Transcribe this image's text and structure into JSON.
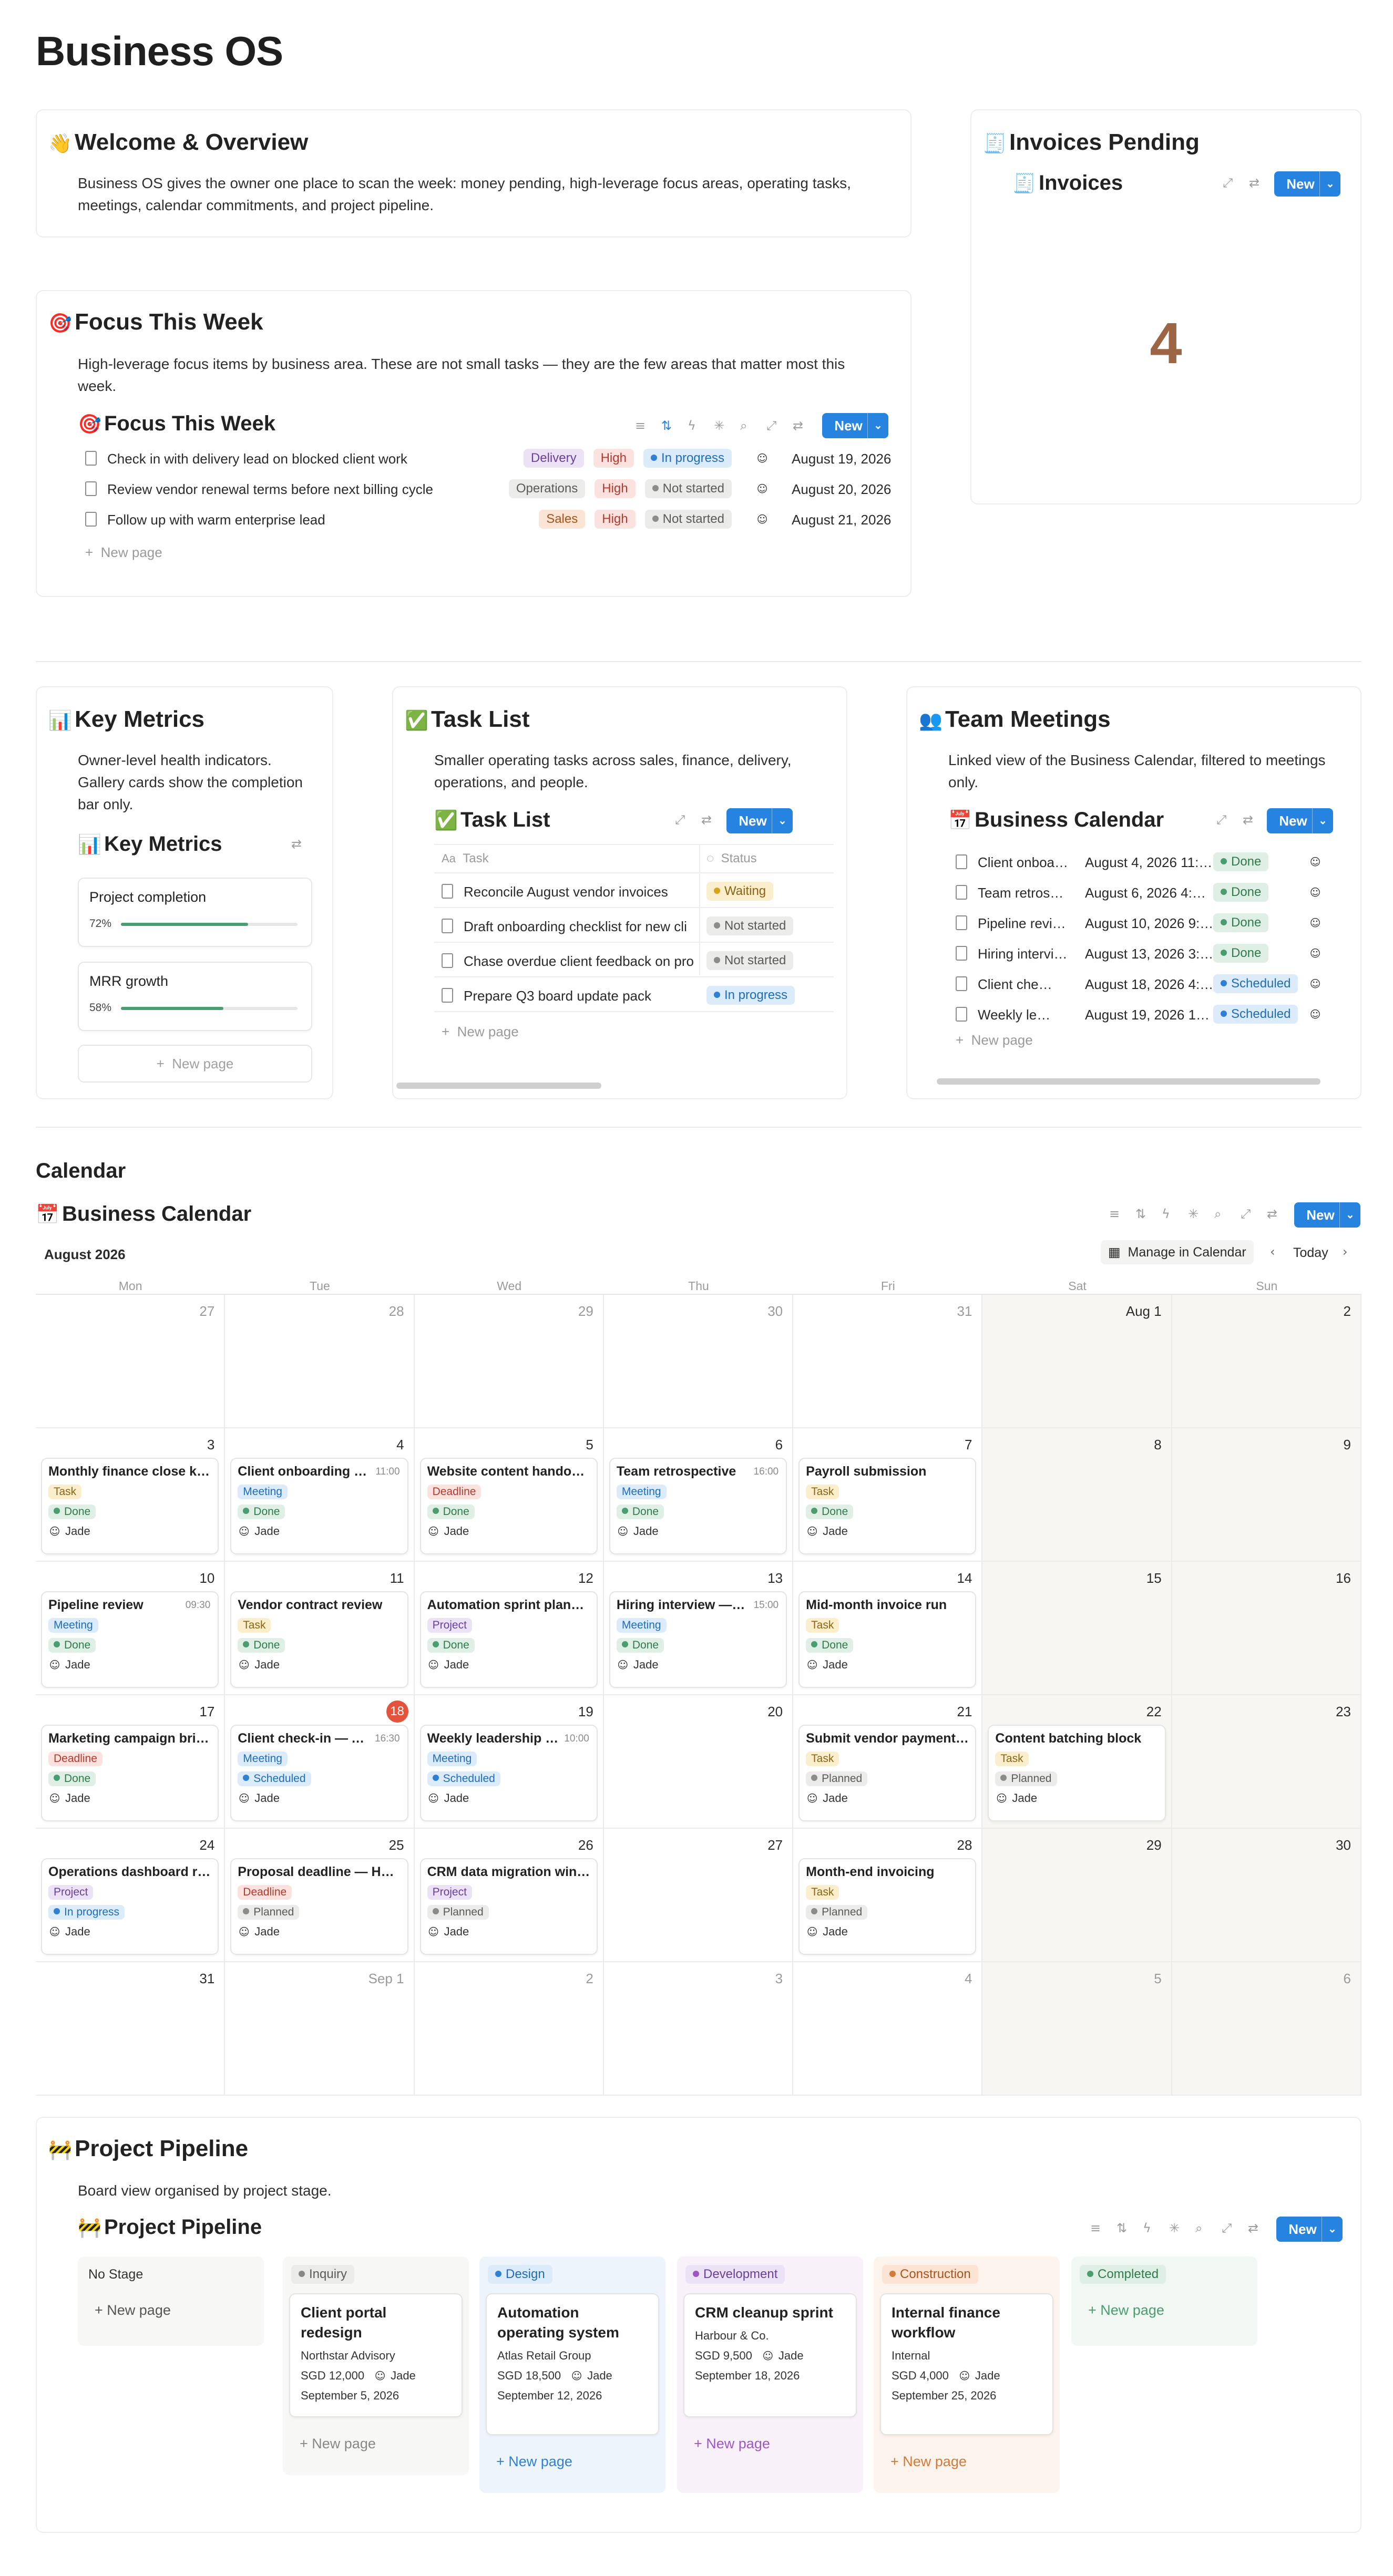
{
  "page": {
    "title": "Business OS"
  },
  "welcome": {
    "emoji": "👋",
    "title": "Welcome & Overview",
    "desc": "Business OS gives the owner one place to scan the week: money pending, high-leverage focus areas, operating tasks, meetings, calendar commitments, and project pipeline."
  },
  "invoices": {
    "emoji": "🧾",
    "title": "Invoices Pending",
    "view_title": "Invoices",
    "new_label": "New",
    "count": "4"
  },
  "focus": {
    "emoji": "🎯",
    "title": "Focus This Week",
    "desc": "High-leverage focus items by business area. These are not small tasks — they are the few areas that matter most this week.",
    "view_title": "Focus This Week",
    "new_label": "New",
    "new_page": "New page",
    "rows": [
      {
        "title": "Check in with delivery lead on blocked client work",
        "area": "Delivery",
        "priority": "High",
        "status": "In progress",
        "date": "August 19, 2026"
      },
      {
        "title": "Review vendor renewal terms before next billing cycle",
        "area": "Operations",
        "priority": "High",
        "status": "Not started",
        "date": "August 20, 2026"
      },
      {
        "title": "Follow up with warm enterprise lead",
        "area": "Sales",
        "priority": "High",
        "status": "Not started",
        "date": "August 21, 2026"
      }
    ]
  },
  "metrics": {
    "emoji": "📊",
    "title": "Key Metrics",
    "desc": "Owner-level health indicators. Gallery cards show the completion bar only.",
    "view_title": "Key Metrics",
    "new_page": "New page",
    "cards": [
      {
        "name": "Project completion",
        "pct_label": "72%",
        "pct": 0.72
      },
      {
        "name": "MRR growth",
        "pct_label": "58%",
        "pct": 0.58
      }
    ]
  },
  "tasks": {
    "emoji": "✅",
    "title": "Task List",
    "desc": "Smaller operating tasks across sales, finance, delivery, operations, and people.",
    "view_title": "Task List",
    "new_label": "New",
    "col_task": "Task",
    "col_status": "Status",
    "new_page": "New page",
    "rows": [
      {
        "title": "Reconcile August vendor invoices",
        "status": "Waiting"
      },
      {
        "title": "Draft onboarding checklist for new cli",
        "status": "Not started"
      },
      {
        "title": "Chase overdue client feedback on pro",
        "status": "Not started"
      },
      {
        "title": "Prepare Q3 board update pack",
        "status": "In progress"
      }
    ]
  },
  "meetings": {
    "emoji": "👥",
    "title": "Team Meetings",
    "desc": "Linked view of the Business Calendar, filtered to meetings only.",
    "view_title": "Business Calendar",
    "new_label": "New",
    "new_page": "New page",
    "rows": [
      {
        "title": "Client onboa…",
        "date": "August 4, 2026 11:…",
        "status": "Done"
      },
      {
        "title": "Team retros…",
        "date": "August 6, 2026 4:…",
        "status": "Done"
      },
      {
        "title": "Pipeline revi…",
        "date": "August 10, 2026 9:…",
        "status": "Done"
      },
      {
        "title": "Hiring intervi…",
        "date": "August 13, 2026 3:…",
        "status": "Done"
      },
      {
        "title": "Client che…",
        "date": "August 18, 2026 4:…",
        "status": "Scheduled"
      },
      {
        "title": "Weekly le…",
        "date": "August 19, 2026 1…",
        "status": "Scheduled"
      }
    ]
  },
  "calendar": {
    "section_title": "Calendar",
    "view_title": "Business Calendar",
    "new_label": "New",
    "month": "August 2026",
    "manage_label": "Manage in Calendar",
    "today_label": "Today",
    "weekdays": [
      "Mon",
      "Tue",
      "Wed",
      "Thu",
      "Fri",
      "Sat",
      "Sun"
    ],
    "weeks": [
      [
        {
          "n": "27",
          "dim": true
        },
        {
          "n": "28",
          "dim": true
        },
        {
          "n": "29",
          "dim": true
        },
        {
          "n": "30",
          "dim": true
        },
        {
          "n": "31",
          "dim": true
        },
        {
          "n": "Aug 1"
        },
        {
          "n": "2"
        }
      ],
      [
        {
          "n": "3",
          "ev": {
            "title": "Monthly finance close ki…",
            "type": "Task",
            "status": "Done"
          }
        },
        {
          "n": "4",
          "ev": {
            "title": "Client onboarding c…",
            "time": "11:00",
            "type": "Meeting",
            "status": "Done"
          }
        },
        {
          "n": "5",
          "ev": {
            "title": "Website content handov…",
            "type": "Deadline",
            "status": "Done"
          }
        },
        {
          "n": "6",
          "ev": {
            "title": "Team retrospective",
            "time": "16:00",
            "type": "Meeting",
            "status": "Done"
          }
        },
        {
          "n": "7",
          "ev": {
            "title": "Payroll submission",
            "type": "Task",
            "status": "Done"
          }
        },
        {
          "n": "8"
        },
        {
          "n": "9"
        }
      ],
      [
        {
          "n": "10",
          "ev": {
            "title": "Pipeline review",
            "time": "09:30",
            "type": "Meeting",
            "status": "Done"
          }
        },
        {
          "n": "11",
          "ev": {
            "title": "Vendor contract review",
            "type": "Task",
            "status": "Done"
          }
        },
        {
          "n": "12",
          "ev": {
            "title": "Automation sprint plann…",
            "type": "Project",
            "status": "Done"
          }
        },
        {
          "n": "13",
          "ev": {
            "title": "Hiring interview — …",
            "time": "15:00",
            "type": "Meeting",
            "status": "Done"
          }
        },
        {
          "n": "14",
          "ev": {
            "title": "Mid-month invoice run",
            "type": "Task",
            "status": "Done"
          }
        },
        {
          "n": "15"
        },
        {
          "n": "16"
        }
      ],
      [
        {
          "n": "17",
          "ev": {
            "title": "Marketing campaign bri…",
            "type": "Deadline",
            "status": "Done"
          }
        },
        {
          "n": "18",
          "today": true,
          "ev": {
            "title": "Client check-in — A…",
            "time": "16:30",
            "type": "Meeting",
            "status": "Scheduled"
          }
        },
        {
          "n": "19",
          "ev": {
            "title": "Weekly leadership …",
            "time": "10:00",
            "type": "Meeting",
            "status": "Scheduled"
          }
        },
        {
          "n": "20"
        },
        {
          "n": "21",
          "ev": {
            "title": "Submit vendor payment…",
            "type": "Task",
            "status": "Planned"
          }
        },
        {
          "n": "22",
          "ev": {
            "title": "Content batching block",
            "type": "Task",
            "status": "Planned"
          }
        },
        {
          "n": "23"
        }
      ],
      [
        {
          "n": "24",
          "ev": {
            "title": "Operations dashboard r…",
            "type": "Project",
            "status": "In progress"
          }
        },
        {
          "n": "25",
          "ev": {
            "title": "Proposal deadline — Ha…",
            "type": "Deadline",
            "status": "Planned"
          }
        },
        {
          "n": "26",
          "ev": {
            "title": "CRM data migration win…",
            "type": "Project",
            "status": "Planned"
          }
        },
        {
          "n": "27"
        },
        {
          "n": "28",
          "ev": {
            "title": "Month-end invoicing",
            "type": "Task",
            "status": "Planned"
          }
        },
        {
          "n": "29"
        },
        {
          "n": "30"
        }
      ],
      [
        {
          "n": "31"
        },
        {
          "n": "Sep 1",
          "dim": true
        },
        {
          "n": "2",
          "dim": true
        },
        {
          "n": "3",
          "dim": true
        },
        {
          "n": "4",
          "dim": true
        },
        {
          "n": "5",
          "dim": true
        },
        {
          "n": "6",
          "dim": true
        }
      ]
    ],
    "assignee": "Jade"
  },
  "pipeline": {
    "emoji": "🚧",
    "title": "Project Pipeline",
    "desc": "Board view organised by project stage.",
    "view_title": "Project Pipeline",
    "new_label": "New",
    "new_page": "New page",
    "columns": [
      {
        "name": "No Stage",
        "cards": []
      },
      {
        "name": "Inquiry",
        "cards": [
          {
            "title": "Client portal redesign",
            "client": "Northstar Advisory",
            "value": "SGD 12,000",
            "owner": "Jade",
            "date": "September 5, 2026"
          }
        ]
      },
      {
        "name": "Design",
        "cards": [
          {
            "title": "Automation operating system",
            "client": "Atlas Retail Group",
            "value": "SGD 18,500",
            "owner": "Jade",
            "date": "September 12, 2026"
          }
        ]
      },
      {
        "name": "Development",
        "cards": [
          {
            "title": "CRM cleanup sprint",
            "client": "Harbour & Co.",
            "value": "SGD 9,500",
            "owner": "Jade",
            "date": "September 18, 2026"
          }
        ]
      },
      {
        "name": "Construction",
        "cards": [
          {
            "title": "Internal finance workflow",
            "client": "Internal",
            "value": "SGD 4,000",
            "owner": "Jade",
            "date": "September 25, 2026"
          }
        ]
      },
      {
        "name": "Completed",
        "cards": []
      }
    ]
  },
  "colors": {
    "accent": "#2683e0",
    "count": "#9c6644",
    "today": "#e5533d"
  }
}
